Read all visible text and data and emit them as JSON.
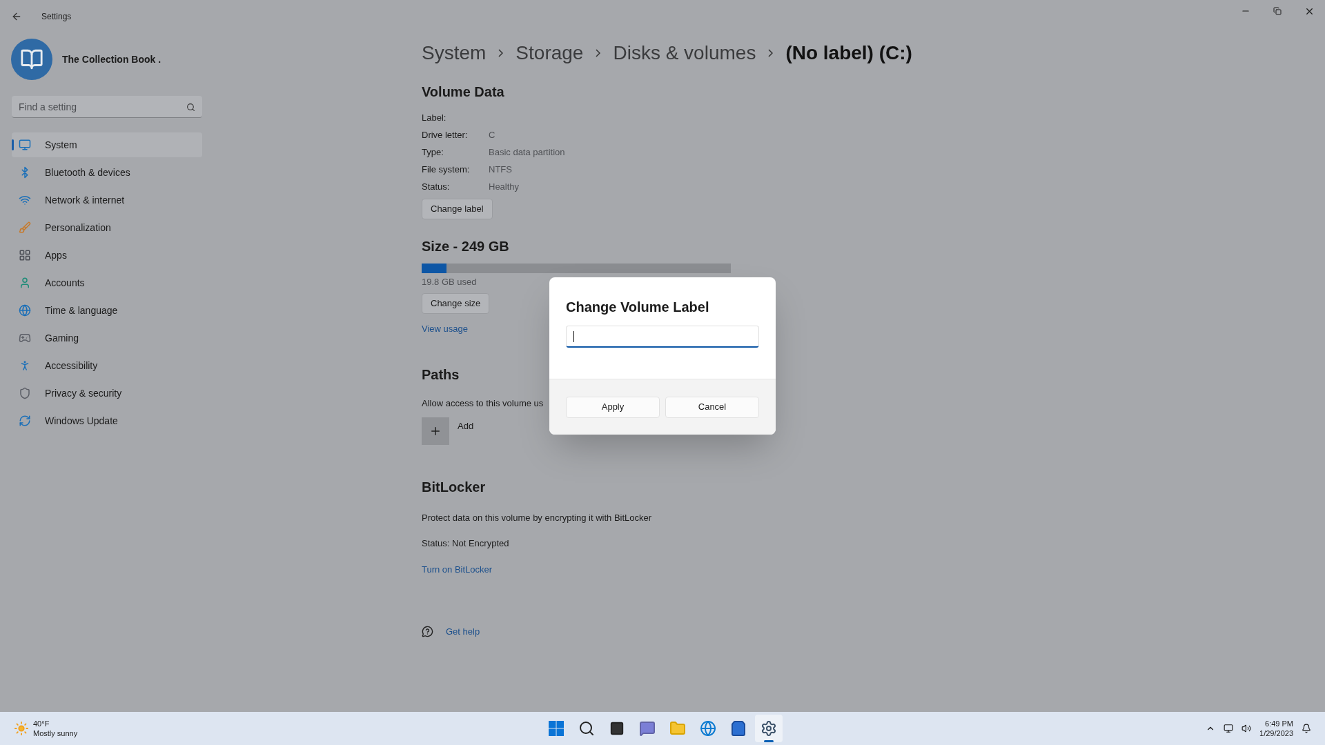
{
  "window": {
    "title": "Settings"
  },
  "account": {
    "name": "The Collection Book ."
  },
  "search": {
    "placeholder": "Find a setting"
  },
  "nav": [
    {
      "label": "System",
      "selected": true
    },
    {
      "label": "Bluetooth & devices",
      "selected": false
    },
    {
      "label": "Network & internet",
      "selected": false
    },
    {
      "label": "Personalization",
      "selected": false
    },
    {
      "label": "Apps",
      "selected": false
    },
    {
      "label": "Accounts",
      "selected": false
    },
    {
      "label": "Time & language",
      "selected": false
    },
    {
      "label": "Gaming",
      "selected": false
    },
    {
      "label": "Accessibility",
      "selected": false
    },
    {
      "label": "Privacy & security",
      "selected": false
    },
    {
      "label": "Windows Update",
      "selected": false
    }
  ],
  "breadcrumb": [
    "System",
    "Storage",
    "Disks & volumes",
    "(No label) (C:)"
  ],
  "volume_data": {
    "title": "Volume Data",
    "rows": [
      {
        "label": "Label:"
      },
      {
        "label": "Drive letter:",
        "value": "C"
      },
      {
        "label": "Type:",
        "value": "Basic data partition"
      },
      {
        "label": "File system:",
        "value": "NTFS"
      },
      {
        "label": "Status:",
        "value": "Healthy"
      }
    ],
    "button": "Change label"
  },
  "size": {
    "title": "Size - 249 GB",
    "level": 0.08,
    "used": "19.8 GB used",
    "button": "Change size",
    "link": "View usage"
  },
  "paths": {
    "title": "Paths",
    "description": "Allow access to this volume us",
    "add": "Add"
  },
  "bitlocker": {
    "title": "BitLocker",
    "description": "Protect data on this volume by encrypting it with BitLocker",
    "status": "Status: Not Encrypted",
    "link": "Turn on BitLocker"
  },
  "help": {
    "link": "Get help"
  },
  "dialog": {
    "title": "Change Volume Label",
    "focused": true,
    "buttons": [
      "Apply",
      "Cancel"
    ]
  },
  "taskbar": {
    "weather": {
      "temperature": "40°F",
      "condition": "Mostly sunny"
    },
    "apps": [
      {
        "selected": false
      },
      {
        "selected": false
      },
      {
        "selected": false
      },
      {
        "selected": false
      },
      {
        "selected": false
      },
      {
        "selected": false
      },
      {
        "selected": false
      },
      {
        "selected": true
      }
    ],
    "time": "6:49 PM",
    "date": "1/29/2023"
  }
}
